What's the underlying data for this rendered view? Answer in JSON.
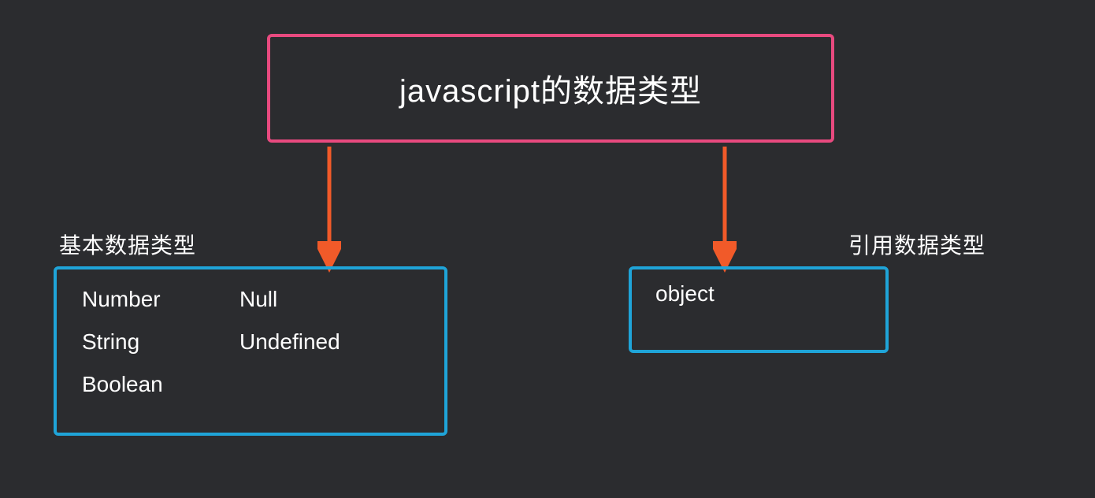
{
  "title": "javascript的数据类型",
  "basic": {
    "label": "基本数据类型",
    "items_left": [
      "Number",
      "String",
      "Boolean"
    ],
    "items_right": [
      "Null",
      "Undefined"
    ]
  },
  "reference": {
    "label": "引用数据类型",
    "items": [
      "object"
    ]
  },
  "colors": {
    "background": "#2b2c2f",
    "title_border": "#e84a7f",
    "box_border": "#1fa4d8",
    "arrow": "#f15a29",
    "text": "#ffffff"
  }
}
